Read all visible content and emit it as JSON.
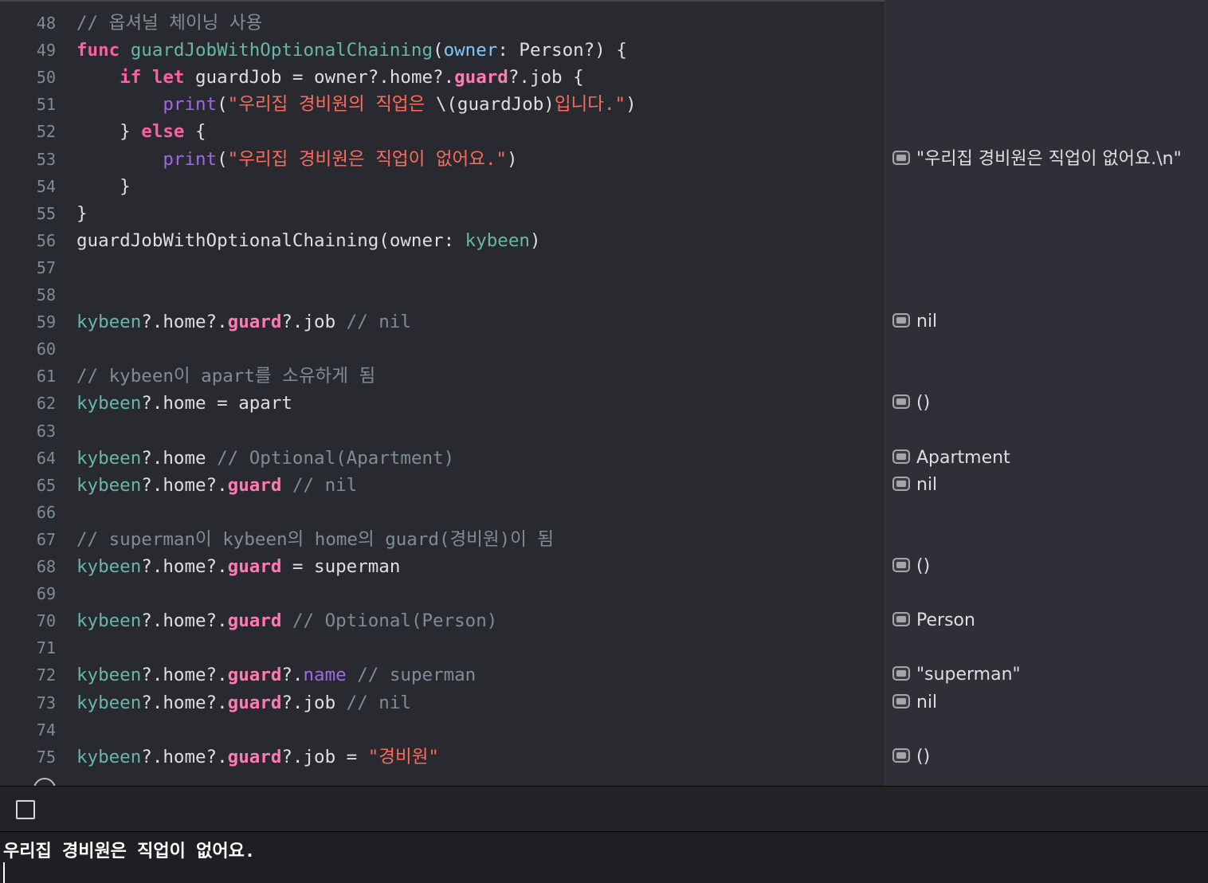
{
  "editor": {
    "lines": [
      {
        "n": "48",
        "parts": [
          {
            "c": "cm",
            "t": "// 옵셔널 체이닝 사용"
          }
        ]
      },
      {
        "n": "49",
        "parts": [
          {
            "c": "kw",
            "t": "func "
          },
          {
            "c": "fn",
            "t": "guardJobWithOptionalChaining"
          },
          {
            "c": "plain",
            "t": "("
          },
          {
            "c": "lbl",
            "t": "owner"
          },
          {
            "c": "plain",
            "t": ": Person?) {"
          }
        ]
      },
      {
        "n": "50",
        "parts": [
          {
            "c": "plain",
            "t": "    "
          },
          {
            "c": "kw",
            "t": "if let "
          },
          {
            "c": "plain",
            "t": "guardJob = owner?.home?."
          },
          {
            "c": "prop",
            "t": "guard"
          },
          {
            "c": "plain",
            "t": "?.job {"
          }
        ]
      },
      {
        "n": "51",
        "parts": [
          {
            "c": "plain",
            "t": "        "
          },
          {
            "c": "name",
            "t": "print"
          },
          {
            "c": "plain",
            "t": "("
          },
          {
            "c": "str",
            "t": "\"우리집 경비원의 직업은 "
          },
          {
            "c": "plain",
            "t": "\\(guardJob)"
          },
          {
            "c": "str",
            "t": "입니다.\""
          },
          {
            "c": "plain",
            "t": ")"
          }
        ]
      },
      {
        "n": "52",
        "parts": [
          {
            "c": "plain",
            "t": "    } "
          },
          {
            "c": "kw",
            "t": "else"
          },
          {
            "c": "plain",
            "t": " {"
          }
        ]
      },
      {
        "n": "53",
        "parts": [
          {
            "c": "plain",
            "t": "        "
          },
          {
            "c": "name",
            "t": "print"
          },
          {
            "c": "plain",
            "t": "("
          },
          {
            "c": "str",
            "t": "\"우리집 경비원은 직업이 없어요.\""
          },
          {
            "c": "plain",
            "t": ")"
          }
        ]
      },
      {
        "n": "54",
        "parts": [
          {
            "c": "plain",
            "t": "    }"
          }
        ]
      },
      {
        "n": "55",
        "parts": [
          {
            "c": "plain",
            "t": "}"
          }
        ]
      },
      {
        "n": "56",
        "parts": [
          {
            "c": "plain",
            "t": "guardJobWithOptionalChaining(owner: "
          },
          {
            "c": "var",
            "t": "kybeen"
          },
          {
            "c": "plain",
            "t": ")"
          }
        ]
      },
      {
        "n": "57",
        "parts": []
      },
      {
        "n": "58",
        "parts": []
      },
      {
        "n": "59",
        "parts": [
          {
            "c": "var",
            "t": "kybeen"
          },
          {
            "c": "plain",
            "t": "?.home?."
          },
          {
            "c": "prop",
            "t": "guard"
          },
          {
            "c": "plain",
            "t": "?.job "
          },
          {
            "c": "cm",
            "t": "// nil"
          }
        ]
      },
      {
        "n": "60",
        "parts": []
      },
      {
        "n": "61",
        "parts": [
          {
            "c": "cm",
            "t": "// kybeen이 apart를 소유하게 됨"
          }
        ]
      },
      {
        "n": "62",
        "parts": [
          {
            "c": "var",
            "t": "kybeen"
          },
          {
            "c": "plain",
            "t": "?.home = apart"
          }
        ]
      },
      {
        "n": "63",
        "parts": []
      },
      {
        "n": "64",
        "parts": [
          {
            "c": "var",
            "t": "kybeen"
          },
          {
            "c": "plain",
            "t": "?.home "
          },
          {
            "c": "cm",
            "t": "// Optional(Apartment)"
          }
        ]
      },
      {
        "n": "65",
        "parts": [
          {
            "c": "var",
            "t": "kybeen"
          },
          {
            "c": "plain",
            "t": "?.home?."
          },
          {
            "c": "prop",
            "t": "guard"
          },
          {
            "c": "plain",
            "t": " "
          },
          {
            "c": "cm",
            "t": "// nil"
          }
        ]
      },
      {
        "n": "66",
        "parts": []
      },
      {
        "n": "67",
        "parts": [
          {
            "c": "cm",
            "t": "// superman이 kybeen의 home의 guard(경비원)이 됨"
          }
        ]
      },
      {
        "n": "68",
        "parts": [
          {
            "c": "var",
            "t": "kybeen"
          },
          {
            "c": "plain",
            "t": "?.home?."
          },
          {
            "c": "prop",
            "t": "guard"
          },
          {
            "c": "plain",
            "t": " = superman"
          }
        ]
      },
      {
        "n": "69",
        "parts": []
      },
      {
        "n": "70",
        "parts": [
          {
            "c": "var",
            "t": "kybeen"
          },
          {
            "c": "plain",
            "t": "?.home?."
          },
          {
            "c": "prop",
            "t": "guard"
          },
          {
            "c": "plain",
            "t": " "
          },
          {
            "c": "cm",
            "t": "// Optional(Person)"
          }
        ]
      },
      {
        "n": "71",
        "parts": []
      },
      {
        "n": "72",
        "parts": [
          {
            "c": "var",
            "t": "kybeen"
          },
          {
            "c": "plain",
            "t": "?.home?."
          },
          {
            "c": "prop",
            "t": "guard"
          },
          {
            "c": "plain",
            "t": "?."
          },
          {
            "c": "name",
            "t": "name"
          },
          {
            "c": "plain",
            "t": " "
          },
          {
            "c": "cm",
            "t": "// superman"
          }
        ]
      },
      {
        "n": "73",
        "parts": [
          {
            "c": "var",
            "t": "kybeen"
          },
          {
            "c": "plain",
            "t": "?.home?."
          },
          {
            "c": "prop",
            "t": "guard"
          },
          {
            "c": "plain",
            "t": "?.job "
          },
          {
            "c": "cm",
            "t": "// nil"
          }
        ]
      },
      {
        "n": "74",
        "parts": []
      },
      {
        "n": "75",
        "parts": [
          {
            "c": "var",
            "t": "kybeen"
          },
          {
            "c": "plain",
            "t": "?.home?."
          },
          {
            "c": "prop",
            "t": "guard"
          },
          {
            "c": "plain",
            "t": "?.job = "
          },
          {
            "c": "str",
            "t": "\"경비원\""
          }
        ]
      }
    ]
  },
  "results": [
    {
      "line": "53",
      "text": "\"우리집 경비원은 직업이 없어요.\\n\""
    },
    {
      "line": "59",
      "text": "nil"
    },
    {
      "line": "62",
      "text": "()"
    },
    {
      "line": "64",
      "text": "Apartment"
    },
    {
      "line": "65",
      "text": "nil"
    },
    {
      "line": "68",
      "text": "()"
    },
    {
      "line": "70",
      "text": "Person"
    },
    {
      "line": "72",
      "text": "\"superman\""
    },
    {
      "line": "73",
      "text": "nil"
    },
    {
      "line": "75",
      "text": "()"
    }
  ],
  "console": {
    "output": "우리집 경비원은 직업이 없어요."
  },
  "colors": {
    "background": "#292a30",
    "keyword": "#fc5fa3",
    "string": "#fc6a5d",
    "comment": "#7f8c98",
    "identifier": "#67b7a4"
  },
  "icons": {
    "result_marker": "quick-look-icon",
    "console_toggle": "checkbox-icon"
  }
}
